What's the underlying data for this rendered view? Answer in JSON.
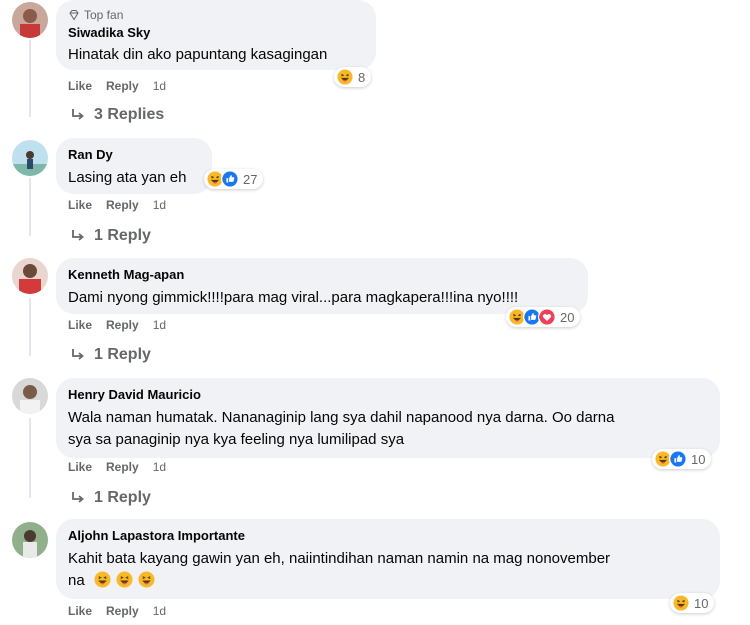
{
  "comments": [
    {
      "badge": "Top fan",
      "name": "Siwadika Sky",
      "text": "Hinatak din ako papuntang kasagingan",
      "like": "Like",
      "reply": "Reply",
      "time": "1d",
      "reaction_count": "8",
      "replies_label": "3 Replies"
    },
    {
      "name": "Ran Dy",
      "text": "Lasing ata yan eh",
      "like": "Like",
      "reply": "Reply",
      "time": "1d",
      "reaction_count": "27",
      "replies_label": "1 Reply"
    },
    {
      "name": "Kenneth Mag-apan",
      "text": "Dami nyong gimmick!!!!para mag viral...para magkapera!!!ina nyo!!!!",
      "like": "Like",
      "reply": "Reply",
      "time": "1d",
      "reaction_count": "20",
      "replies_label": "1 Reply"
    },
    {
      "name": "Henry David Mauricio",
      "text_line1": "Wala naman humatak. Nananaginip lang sya dahil napanood nya darna. Oo darna",
      "text_line2": "sya sa panaginip nya kya feeling nya lumilipad sya",
      "like": "Like",
      "reply": "Reply",
      "time": "1d",
      "reaction_count": "10",
      "replies_label": "1 Reply"
    },
    {
      "name": "Aljohn Lapastora Importante",
      "text_line1": "Kahit bata kayang gawin yan eh, naiintindihan naman namin na mag nonovember",
      "text_line2": "na",
      "like": "Like",
      "reply": "Reply",
      "time": "1d",
      "reaction_count": "10"
    }
  ],
  "icons": {
    "haha": "haha-reaction-icon",
    "like": "like-reaction-icon",
    "love": "love-reaction-icon"
  },
  "colors": {
    "bubble": "#f0f2f5",
    "secondary_text": "#65676b",
    "like_blue": "#1877f2",
    "love_red": "#f33e58",
    "haha_yellow": "#f7b125"
  }
}
